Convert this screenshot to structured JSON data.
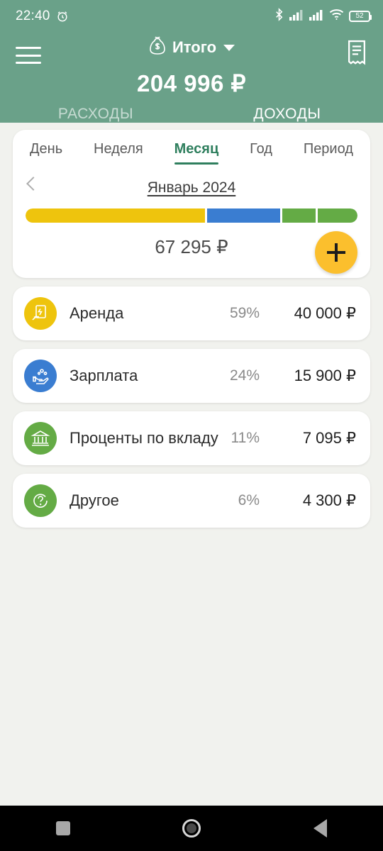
{
  "statusbar": {
    "time": "22:40",
    "alarm_icon": "alarm-icon",
    "bluetooth_icon": "bluetooth-icon",
    "signal_icon_1": "signal-bars-icon",
    "signal_icon_2": "signal-bars-icon",
    "wifi_icon": "wifi-icon",
    "battery_level": "52"
  },
  "header": {
    "menu_icon": "hamburger-menu-icon",
    "account_icon": "money-bag-icon",
    "account_label": "Итого",
    "dropdown_icon": "chevron-down-icon",
    "receipt_icon": "receipt-icon",
    "total_amount": "204 996 ₽",
    "background_color": "#6aa189",
    "tabs": [
      {
        "label": "РАСХОДЫ",
        "active": false
      },
      {
        "label": "ДОХОДЫ",
        "active": true
      }
    ]
  },
  "summary": {
    "range_tabs": [
      {
        "label": "День",
        "active": false
      },
      {
        "label": "Неделя",
        "active": false
      },
      {
        "label": "Месяц",
        "active": true
      },
      {
        "label": "Год",
        "active": false
      },
      {
        "label": "Период",
        "active": false
      }
    ],
    "prev_icon": "chevron-left-icon",
    "period_label": "Январь 2024",
    "period_total": "67 295 ₽",
    "add_button_label": "+",
    "add_button_color": "#fbbf2d",
    "accent_color": "#2f7f5e"
  },
  "chart_data": {
    "type": "bar",
    "title": "Январь 2024",
    "categories": [
      "Аренда",
      "Зарплата",
      "Проценты по вкладу",
      "Другое"
    ],
    "values": [
      40000,
      15900,
      7095,
      4300
    ],
    "percents": [
      59,
      24,
      11,
      6
    ],
    "colors": [
      "#eec40d",
      "#3a7dd1",
      "#64ab45",
      "#64ab45"
    ],
    "total": 67295,
    "unit": "₽",
    "legend_position": "list-below",
    "grid": false
  },
  "categories": [
    {
      "icon": "rent-hand-document-icon",
      "icon_color": "#eec40d",
      "name": "Аренда",
      "percent": "59%",
      "amount": "40 000 ₽"
    },
    {
      "icon": "salary-hand-coins-icon",
      "icon_color": "#3a7dd1",
      "name": "Зарплата",
      "percent": "24%",
      "amount": "15 900 ₽"
    },
    {
      "icon": "bank-building-icon",
      "icon_color": "#64ab45",
      "name": "Проценты по вкладу",
      "percent": "11%",
      "amount": "7 095 ₽"
    },
    {
      "icon": "question-mark-icon",
      "icon_color": "#64ab45",
      "name": "Другое",
      "percent": "6%",
      "amount": "4 300 ₽"
    }
  ],
  "navbar": {
    "recents_icon": "recents-square-icon",
    "home_icon": "home-circle-icon",
    "back_icon": "back-triangle-icon"
  }
}
